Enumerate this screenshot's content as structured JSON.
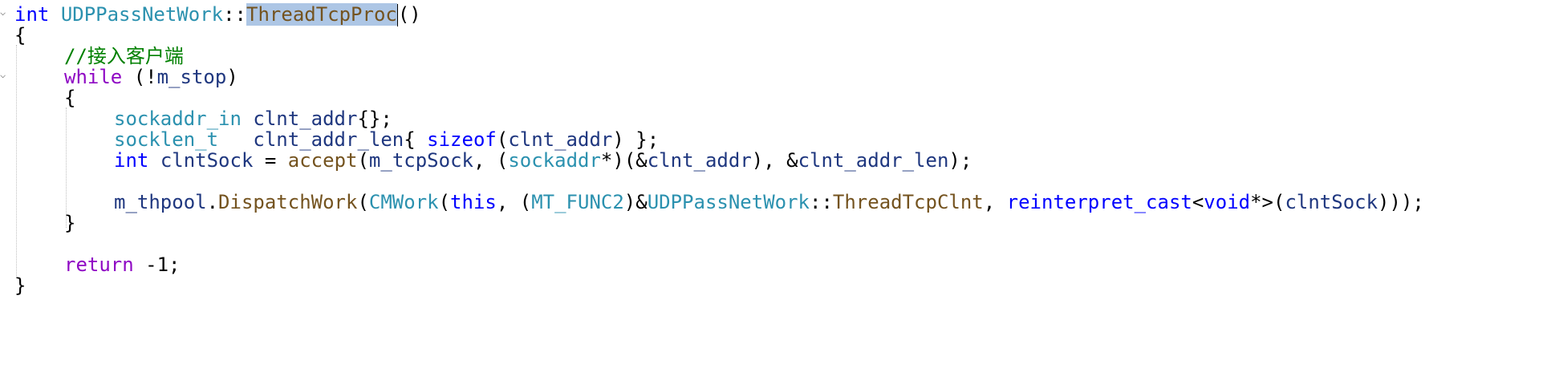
{
  "code": {
    "line1": {
      "ret_type": "int",
      "class_name": "UDPPassNetWork",
      "scope": "::",
      "func_name": "ThreadTcpProc",
      "parens": "()"
    },
    "line2": {
      "brace": "{"
    },
    "line3": {
      "comment": "//接入客户端"
    },
    "line4": {
      "kw": "while",
      "rest_open": " (!",
      "var": "m_stop",
      "rest_close": ")"
    },
    "line5": {
      "brace": "{"
    },
    "line6": {
      "type": "sockaddr_in",
      "space": " ",
      "var": "clnt_addr",
      "rest": "{};"
    },
    "line7": {
      "type": "socklen_t",
      "space": "   ",
      "var": "clnt_addr_len",
      "brace_open": "{ ",
      "kw": "sizeof",
      "paren_open": "(",
      "arg": "clnt_addr",
      "paren_close": ") };"
    },
    "line8": {
      "type": "int",
      "space": " ",
      "var": "clntSock",
      "assign": " = ",
      "func": "accept",
      "p1": "(",
      "arg1": "m_tcpSock",
      "p2": ", (",
      "cast_type": "sockaddr",
      "p3": "*)(&",
      "arg2": "clnt_addr",
      "p4": "), &",
      "arg3": "clnt_addr_len",
      "p5": ");"
    },
    "line9": {
      "obj": "m_thpool",
      "dot": ".",
      "func": "DispatchWork",
      "p1": "(",
      "type1": "CMWork",
      "p2": "(",
      "kw_this": "this",
      "p3": ", (",
      "type2": "MT_FUNC2",
      "p4": ")&",
      "class_name": "UDPPassNetWork",
      "scope": "::",
      "func2": "ThreadTcpClnt",
      "p5": ", ",
      "kw_cast": "reinterpret_cast",
      "p6": "<",
      "kw_void": "void",
      "p7": "*>(",
      "arg": "clntSock",
      "p8": ")));"
    },
    "line10": {
      "brace": "}"
    },
    "line11": {
      "kw": "return",
      "rest": " -1;"
    },
    "line12": {
      "brace": "}"
    }
  },
  "icons": {
    "collapse": "chevron-down-icon"
  },
  "colors": {
    "keyword": "#0000ff",
    "control_keyword": "#8f08c4",
    "type": "#2b91af",
    "function": "#74531f",
    "comment": "#008000",
    "variable": "#1f377f",
    "selection": "#adc6e5"
  }
}
